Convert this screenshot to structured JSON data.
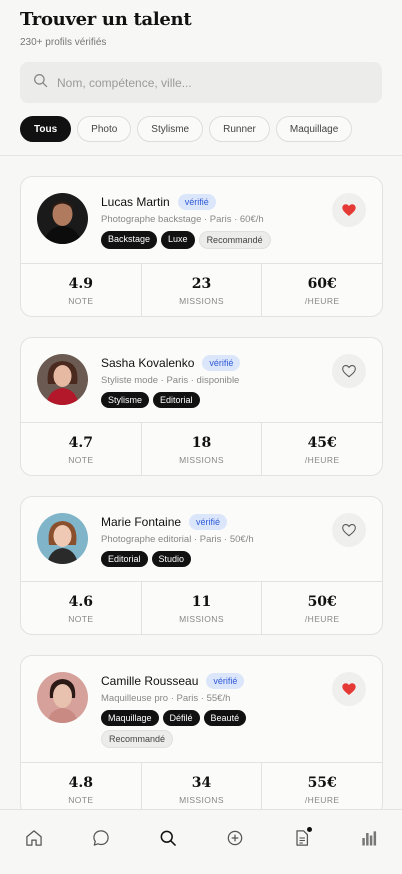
{
  "header": {
    "title": "Trouver un talent",
    "subtitle": "230+ profils vérifiés"
  },
  "search": {
    "placeholder": "Nom, compétence, ville..."
  },
  "filters": [
    "Tous",
    "Photo",
    "Stylisme",
    "Runner",
    "Maquillage"
  ],
  "stat_labels": {
    "note": "NOTE",
    "missions": "MISSIONS",
    "rate": "/HEURE"
  },
  "talents": [
    {
      "name": "Lucas Martin",
      "badge": "vérifié",
      "meta": "Photographe backstage · Paris · 60€/h",
      "tags": [
        "Backstage",
        "Luxe"
      ],
      "extra_tag": "Recommandé",
      "favorite": true,
      "note": "4.9",
      "missions": "23",
      "rate": "60€"
    },
    {
      "name": "Sasha Kovalenko",
      "badge": "vérifié",
      "meta": "Styliste mode · Paris · disponible",
      "tags": [
        "Stylisme",
        "Editorial"
      ],
      "extra_tag": "",
      "favorite": false,
      "note": "4.7",
      "missions": "18",
      "rate": "45€"
    },
    {
      "name": "Marie Fontaine",
      "badge": "vérifié",
      "meta": "Photographe editorial · Paris · 50€/h",
      "tags": [
        "Editorial",
        "Studio"
      ],
      "extra_tag": "",
      "favorite": false,
      "note": "4.6",
      "missions": "11",
      "rate": "50€"
    },
    {
      "name": "Camille Rousseau",
      "badge": "vérifié",
      "meta": "Maquilleuse pro · Paris · 55€/h",
      "tags": [
        "Maquillage",
        "Défilé",
        "Beauté"
      ],
      "extra_tag": "Recommandé",
      "favorite": true,
      "note": "4.8",
      "missions": "34",
      "rate": "55€"
    }
  ],
  "nav": [
    "home-icon",
    "chat-icon",
    "search-icon",
    "add-icon",
    "document-icon",
    "stats-icon"
  ],
  "colors": {
    "accent": "#111111",
    "favorite": "#e53935",
    "verified_bg": "#dce6fb",
    "verified_text": "#2f5bd6"
  }
}
